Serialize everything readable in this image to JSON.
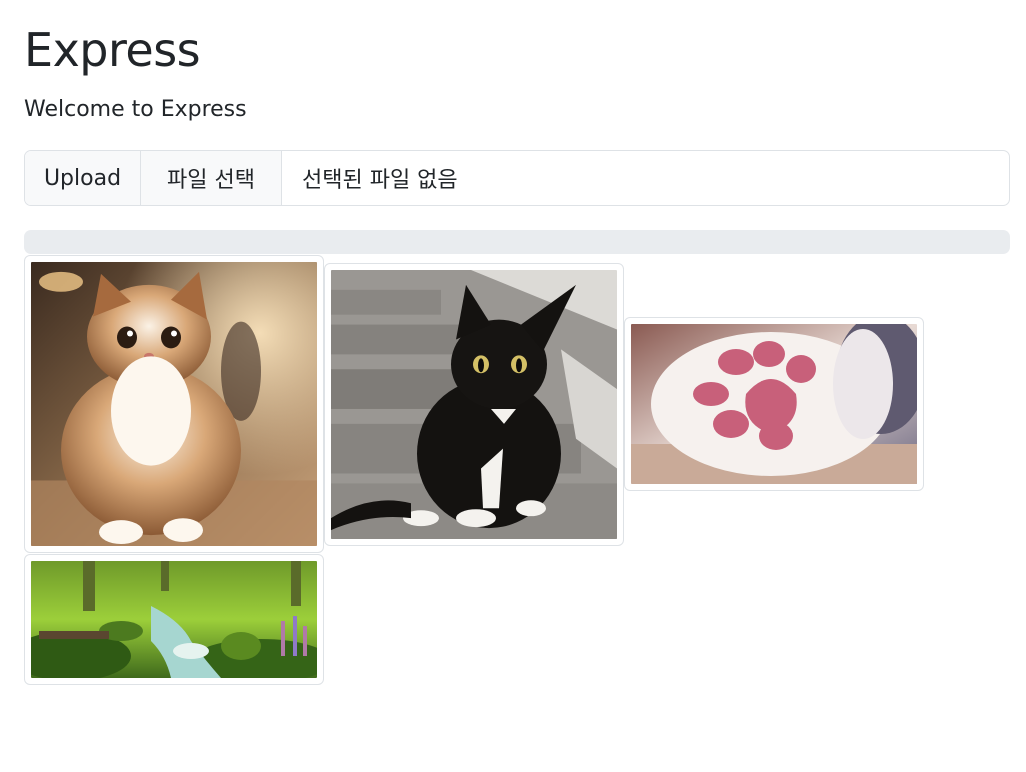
{
  "page": {
    "title": "Express",
    "welcome": "Welcome to Express"
  },
  "upload": {
    "label": "Upload",
    "choose_button": "파일 선택",
    "file_status": "선택된 파일 없음",
    "progress": 0
  },
  "gallery": {
    "images": [
      {
        "subject": "fluffy-kitten-photo"
      },
      {
        "subject": "black-white-cat-photo"
      },
      {
        "subject": "cat-paw-photo"
      },
      {
        "subject": "forest-stream-painting"
      }
    ]
  },
  "colors": {
    "border": "#dee2e6",
    "addon_bg": "#f8f9fa",
    "progress_bg": "#e9ecef",
    "text": "#212529"
  }
}
